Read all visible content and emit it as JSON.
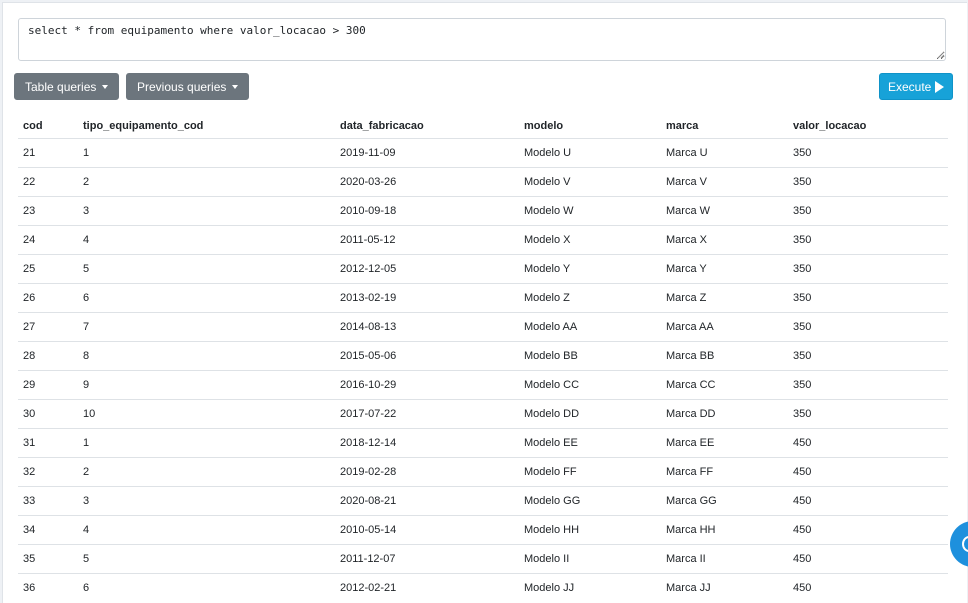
{
  "query": {
    "text": "select * from equipamento where valor_locacao > 300"
  },
  "toolbar": {
    "table_queries_label": "Table queries",
    "previous_queries_label": "Previous queries",
    "execute_label": "Execute"
  },
  "colors": {
    "dropdown_button": "#6c757d",
    "execute_button": "#17a2d8",
    "floating_button": "#1e90dd"
  },
  "results": {
    "columns": [
      "cod",
      "tipo_equipamento_cod",
      "data_fabricacao",
      "modelo",
      "marca",
      "valor_locacao"
    ],
    "rows": [
      [
        "21",
        "1",
        "2019-11-09",
        "Modelo U",
        "Marca U",
        "350"
      ],
      [
        "22",
        "2",
        "2020-03-26",
        "Modelo V",
        "Marca V",
        "350"
      ],
      [
        "23",
        "3",
        "2010-09-18",
        "Modelo W",
        "Marca W",
        "350"
      ],
      [
        "24",
        "4",
        "2011-05-12",
        "Modelo X",
        "Marca X",
        "350"
      ],
      [
        "25",
        "5",
        "2012-12-05",
        "Modelo Y",
        "Marca Y",
        "350"
      ],
      [
        "26",
        "6",
        "2013-02-19",
        "Modelo Z",
        "Marca Z",
        "350"
      ],
      [
        "27",
        "7",
        "2014-08-13",
        "Modelo AA",
        "Marca AA",
        "350"
      ],
      [
        "28",
        "8",
        "2015-05-06",
        "Modelo BB",
        "Marca BB",
        "350"
      ],
      [
        "29",
        "9",
        "2016-10-29",
        "Modelo CC",
        "Marca CC",
        "350"
      ],
      [
        "30",
        "10",
        "2017-07-22",
        "Modelo DD",
        "Marca DD",
        "350"
      ],
      [
        "31",
        "1",
        "2018-12-14",
        "Modelo EE",
        "Marca EE",
        "450"
      ],
      [
        "32",
        "2",
        "2019-02-28",
        "Modelo FF",
        "Marca FF",
        "450"
      ],
      [
        "33",
        "3",
        "2020-08-21",
        "Modelo GG",
        "Marca GG",
        "450"
      ],
      [
        "34",
        "4",
        "2010-05-14",
        "Modelo HH",
        "Marca HH",
        "450"
      ],
      [
        "35",
        "5",
        "2011-12-07",
        "Modelo II",
        "Marca II",
        "450"
      ],
      [
        "36",
        "6",
        "2012-02-21",
        "Modelo JJ",
        "Marca JJ",
        "450"
      ]
    ]
  },
  "floating_button": {
    "icon": "chat-icon"
  }
}
